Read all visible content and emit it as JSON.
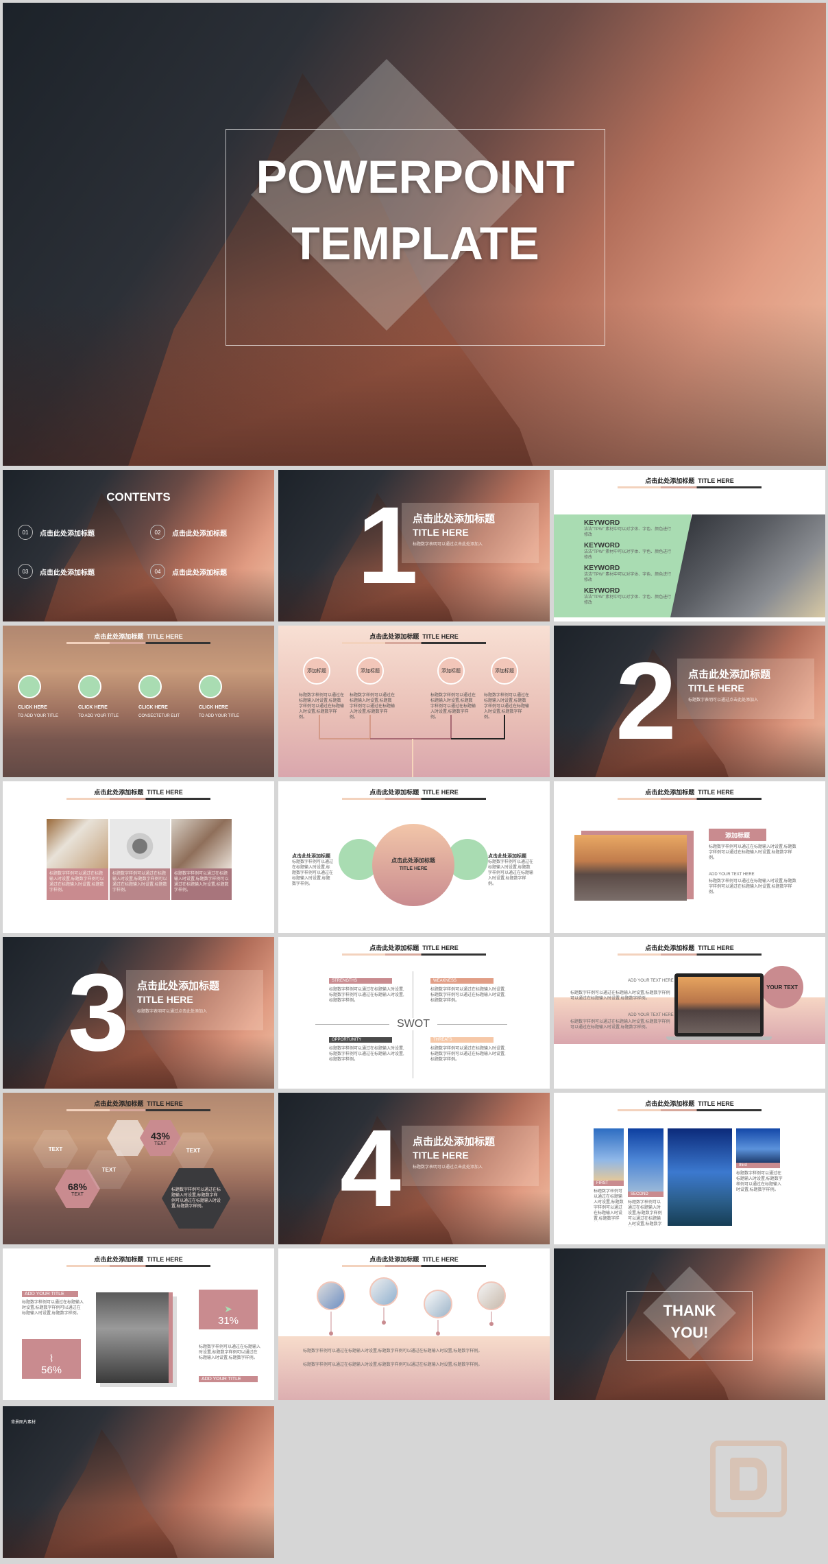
{
  "cover": {
    "title_line1": "POWERPOINT",
    "title_line2": "TEMPLATE"
  },
  "contents": {
    "title": "CONTENTS",
    "items": [
      {
        "num": "01",
        "label": "点击此处添加标题"
      },
      {
        "num": "02",
        "label": "点击此处添加标题"
      },
      {
        "num": "03",
        "label": "点击此处添加标题"
      },
      {
        "num": "04",
        "label": "点击此处添加标题"
      }
    ]
  },
  "header": {
    "cn": "点击此处添加标题",
    "en": "TITLE HERE"
  },
  "section": {
    "cn": "点击此处添加标题",
    "en": "TITLE HERE",
    "desc": "标题数字表明可以通过点击此处添加入",
    "numbers": [
      "1",
      "2",
      "3",
      "4"
    ]
  },
  "body_text": "标题数字样例可以通过在标题输入时设置,标题数字样例可以通过在标题输入时设置,标题数字样例。",
  "keyword": {
    "label": "KEYWORD",
    "desc": "洁洁\"TPW\" 素材中可以对字体、字色、颜色进行修改",
    "count": 4
  },
  "clickhere": {
    "label": "CLICK HERE",
    "subs": [
      "TO ADD YOUR TITLE",
      "TO ADD YOUR TITLE",
      "CONSECTETUR ELIT",
      "TO ADD YOUR TITLE"
    ]
  },
  "addtitle": {
    "label": "添加标题"
  },
  "venn": {
    "center_cn": "点击此处添加标题",
    "center_en": "TITLE HERE",
    "side": "点击此处添加标题"
  },
  "swot": {
    "center": "SWOT",
    "strengths": "STRENGTHS",
    "weakness": "WEAKNESS",
    "opportunity": "OPPORTUNITY",
    "threats": "THREATS"
  },
  "laptop": {
    "your_text": "YOUR TEXT",
    "add": "ADD YOUR TEXT HERE"
  },
  "hexes": {
    "text": "TEXT",
    "p1": "43%",
    "p2": "68%"
  },
  "buildings": {
    "first": "FIRST",
    "second": "SECOND",
    "third": "third"
  },
  "stats": {
    "add_title": "ADD YOUR TITLE",
    "p1": "56%",
    "p2": "31%"
  },
  "thanks": {
    "line1": "THANK",
    "line2": "YOU!"
  },
  "last": {
    "caption": "背景图片素材"
  },
  "colors": {
    "accent": "#b56f7a",
    "rose": "#c98b8f",
    "mint": "#a9dcb2",
    "peach": "#f6c8a8"
  }
}
